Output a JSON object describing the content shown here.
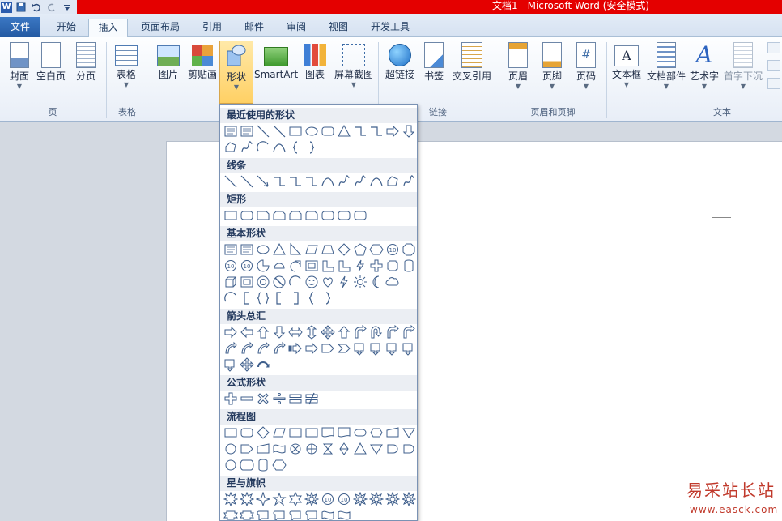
{
  "window": {
    "title": "文档1 - Microsoft Word (安全模式)",
    "app_logo": "W"
  },
  "tabs": [
    {
      "label": "文件"
    },
    {
      "label": "开始"
    },
    {
      "label": "插入"
    },
    {
      "label": "页面布局"
    },
    {
      "label": "引用"
    },
    {
      "label": "邮件"
    },
    {
      "label": "审阅"
    },
    {
      "label": "视图"
    },
    {
      "label": "开发工具"
    }
  ],
  "ribbon": {
    "buttons": [
      {
        "label": "封面",
        "icon": "cover-page-icon"
      },
      {
        "label": "空白页",
        "icon": "blank-page-icon"
      },
      {
        "label": "分页",
        "icon": "page-break-icon"
      },
      {
        "label": "表格",
        "icon": "table-icon"
      },
      {
        "label": "图片",
        "icon": "picture-icon"
      },
      {
        "label": "剪贴画",
        "icon": "clip-art-icon"
      },
      {
        "label": "形状",
        "icon": "shapes-icon"
      },
      {
        "label": "SmartArt",
        "icon": "smartart-icon"
      },
      {
        "label": "图表",
        "icon": "chart-icon"
      },
      {
        "label": "屏幕截图",
        "icon": "screenshot-icon"
      },
      {
        "label": "超链接",
        "icon": "hyperlink-icon"
      },
      {
        "label": "书签",
        "icon": "bookmark-icon"
      },
      {
        "label": "交叉引用",
        "icon": "cross-reference-icon"
      },
      {
        "label": "页眉",
        "icon": "header-icon"
      },
      {
        "label": "页脚",
        "icon": "footer-icon"
      },
      {
        "label": "页码",
        "icon": "page-number-icon"
      },
      {
        "label": "文本框",
        "icon": "text-box-icon"
      },
      {
        "label": "文档部件",
        "icon": "quick-parts-icon"
      },
      {
        "label": "艺术字",
        "icon": "wordart-icon"
      },
      {
        "label": "首字下沉",
        "icon": "drop-cap-icon"
      }
    ],
    "groups": [
      {
        "label": "页"
      },
      {
        "label": "表格"
      },
      {
        "label": "链接"
      },
      {
        "label": "页眉和页脚"
      },
      {
        "label": "文本"
      }
    ]
  },
  "shapes_gallery": {
    "categories": [
      {
        "label": "最近使用的形状"
      },
      {
        "label": "线条"
      },
      {
        "label": "矩形"
      },
      {
        "label": "基本形状"
      },
      {
        "label": "箭头总汇"
      },
      {
        "label": "公式形状"
      },
      {
        "label": "流程图"
      },
      {
        "label": "星与旗帜"
      }
    ]
  },
  "watermark": {
    "text": "易采站长站",
    "url": "www.easck.com"
  },
  "colors": {
    "title_bar": "#e40000",
    "file_tab": "#2b5cad",
    "selected_button": "#ffd064"
  }
}
